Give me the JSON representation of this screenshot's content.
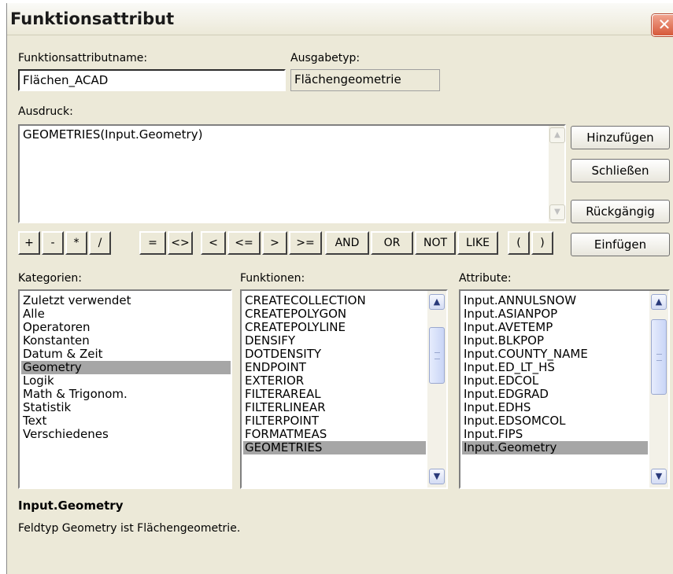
{
  "window": {
    "title": "Funktionsattribut",
    "close_glyph": "✕"
  },
  "name_field": {
    "label": "Funktionsattributname:",
    "value": "Flächen_ACAD"
  },
  "output_type": {
    "label": "Ausgabetyp:",
    "value": "Flächengeometrie"
  },
  "expression": {
    "label": "Ausdruck:",
    "value": "GEOMETRIES(Input.Geometry)"
  },
  "side_buttons": {
    "add": "Hinzufügen",
    "close": "Schließen",
    "undo": "Rückgängig",
    "insert": "Einfügen"
  },
  "operators": [
    "+",
    "-",
    "*",
    "/",
    "=",
    "<>",
    "<",
    "<=",
    ">",
    ">=",
    "AND",
    "OR",
    "NOT",
    "LIKE",
    "(",
    ")"
  ],
  "categories": {
    "label": "Kategorien:",
    "items": [
      "Zuletzt verwendet",
      "Alle",
      "Operatoren",
      "Konstanten",
      "Datum & Zeit",
      "Geometry",
      "Logik",
      "Math & Trigonom.",
      "Statistik",
      "Text",
      "Verschiedenes"
    ],
    "selected": "Geometry"
  },
  "functions": {
    "label": "Funktionen:",
    "items": [
      "CREATECOLLECTION",
      "CREATEPOLYGON",
      "CREATEPOLYLINE",
      "DENSIFY",
      "DOTDENSITY",
      "ENDPOINT",
      "EXTERIOR",
      "FILTERAREAL",
      "FILTERLINEAR",
      "FILTERPOINT",
      "FORMATMEAS",
      "GEOMETRIES"
    ],
    "selected": "GEOMETRIES"
  },
  "attributes": {
    "label": "Attribute:",
    "items": [
      "Input.ANNULSNOW",
      "Input.ASIANPOP",
      "Input.AVETEMP",
      "Input.BLKPOP",
      "Input.COUNTY_NAME",
      "Input.ED_LT_HS",
      "Input.EDCOL",
      "Input.EDGRAD",
      "Input.EDHS",
      "Input.EDSOMCOL",
      "Input.FIPS",
      "Input.Geometry"
    ],
    "selected": "Input.Geometry"
  },
  "description": {
    "title": "Input.Geometry",
    "text": "Feldtyp Geometry ist Flächengeometrie."
  },
  "icons": {
    "scroll_up": "chevron-up-icon",
    "scroll_down": "chevron-down-icon",
    "close": "close-icon"
  }
}
